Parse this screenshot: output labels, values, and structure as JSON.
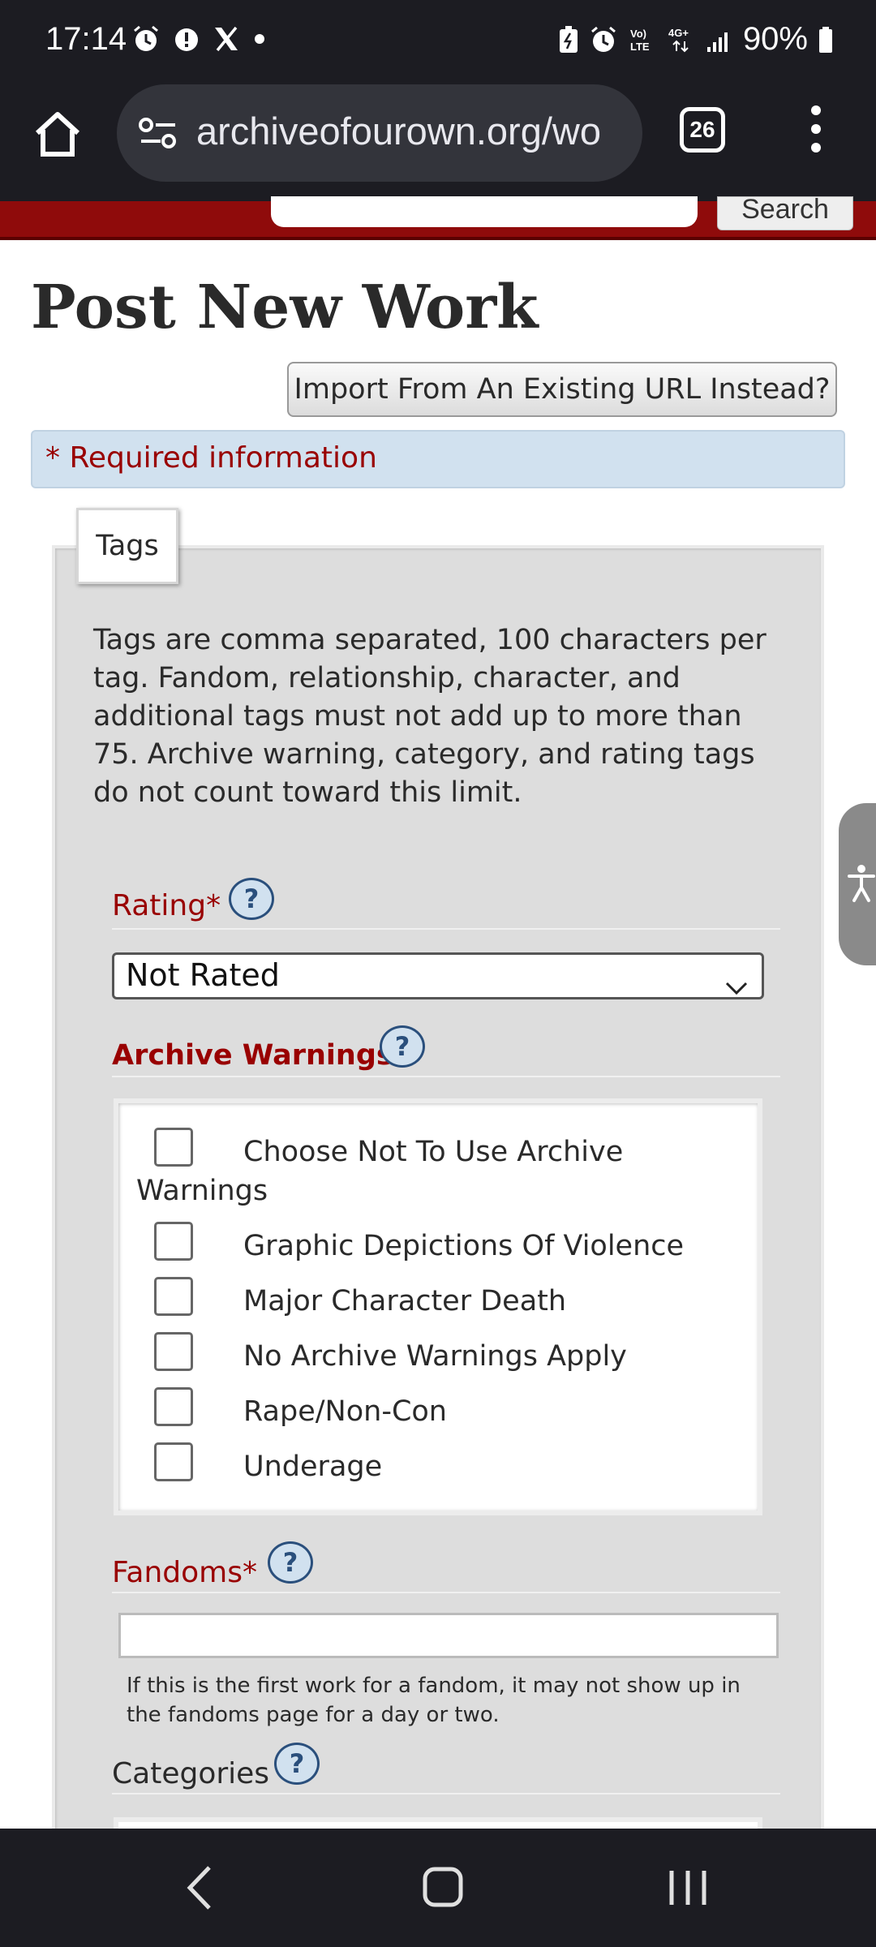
{
  "status_bar": {
    "time": "17:14",
    "battery_percent": "90%",
    "network": "4G+",
    "left_icons": [
      "alarm-icon",
      "alert-icon",
      "x-app-icon",
      "dot-icon"
    ],
    "right_icons": [
      "battery-saver-icon",
      "alarm-icon",
      "volte-icon",
      "4g-icon",
      "signal-icon",
      "battery-icon"
    ]
  },
  "browser": {
    "url": "archiveofourown.org/wo",
    "tab_count": "26"
  },
  "site_header": {
    "search_button_label": "Search"
  },
  "page": {
    "title": "Post New Work",
    "import_button_label": "Import From An Existing URL Instead?",
    "required_note": "* Required information"
  },
  "tags": {
    "legend": "Tags",
    "intro": "Tags are comma separated, 100 characters per tag. Fandom, relationship, character, and additional tags must not add up to more than 75. Archive warning, category, and rating tags do not count toward this limit.",
    "rating": {
      "label": "Rating*",
      "help": "?",
      "selected": "Not Rated"
    },
    "archive_warnings": {
      "label": "Archive Warnings*",
      "help": "?",
      "options": [
        {
          "label": "Choose Not To Use Archive",
          "label_cont": "Warnings",
          "checked": false
        },
        {
          "label": "Graphic Depictions Of Violence",
          "checked": false
        },
        {
          "label": "Major Character Death",
          "checked": false
        },
        {
          "label": "No Archive Warnings Apply",
          "checked": false
        },
        {
          "label": "Rape/Non-Con",
          "checked": false
        },
        {
          "label": "Underage",
          "checked": false
        }
      ]
    },
    "fandoms": {
      "label": "Fandoms*",
      "help": "?",
      "value": "",
      "note": "If this is the first work for a fandom, it may not show up in the fandoms page for a day or two."
    },
    "categories": {
      "label": "Categories",
      "help": "?"
    }
  },
  "colors": {
    "ao3_red": "#990000",
    "header_red": "#8f0b0b",
    "info_blue": "#d1e1ef",
    "chrome_dark": "#1c1c22"
  }
}
